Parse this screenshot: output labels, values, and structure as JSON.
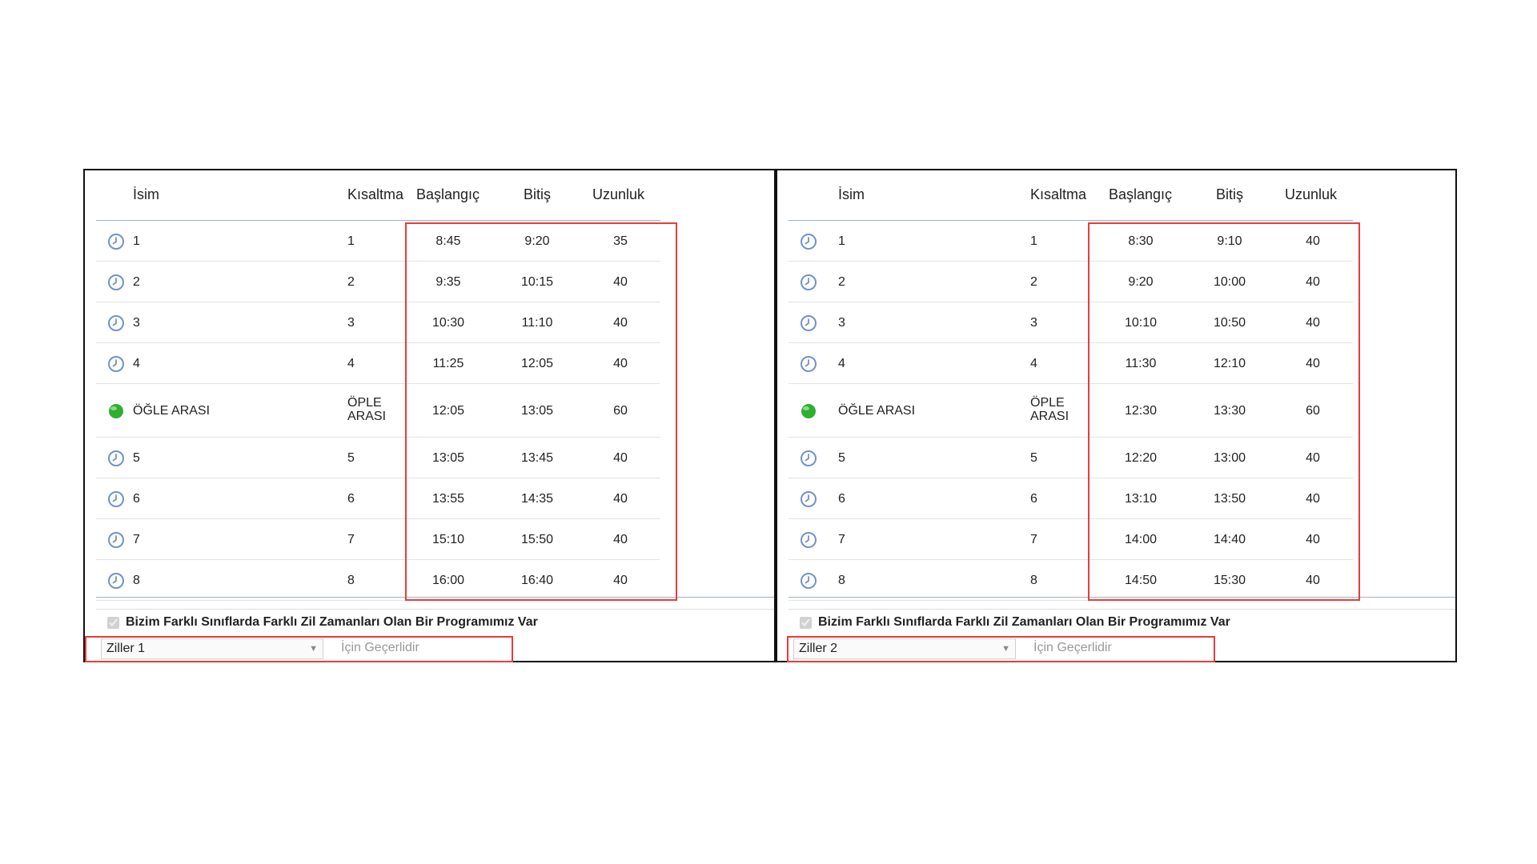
{
  "columns": {
    "name": "İsim",
    "abbr": "Kısaltma",
    "start": "Başlangıç",
    "end": "Bitiş",
    "length": "Uzunluk"
  },
  "left": {
    "rows": [
      {
        "icon": "clock-icon",
        "name": "1",
        "abbr": "1",
        "start": "8:45",
        "end": "9:20",
        "length": "35"
      },
      {
        "icon": "clock-icon",
        "name": "2",
        "abbr": "2",
        "start": "9:35",
        "end": "10:15",
        "length": "40"
      },
      {
        "icon": "clock-icon",
        "name": "3",
        "abbr": "3",
        "start": "10:30",
        "end": "11:10",
        "length": "40"
      },
      {
        "icon": "clock-icon",
        "name": "4",
        "abbr": "4",
        "start": "11:25",
        "end": "12:05",
        "length": "40"
      },
      {
        "icon": "green-dot-icon",
        "name": "ÖĞLE ARASI",
        "abbr_line1": "ÖPLE",
        "abbr_line2": "ARASI",
        "start": "12:05",
        "end": "13:05",
        "length": "60"
      },
      {
        "icon": "clock-icon",
        "name": "5",
        "abbr": "5",
        "start": "13:05",
        "end": "13:45",
        "length": "40"
      },
      {
        "icon": "clock-icon",
        "name": "6",
        "abbr": "6",
        "start": "13:55",
        "end": "14:35",
        "length": "40"
      },
      {
        "icon": "clock-icon",
        "name": "7",
        "abbr": "7",
        "start": "15:10",
        "end": "15:50",
        "length": "40"
      },
      {
        "icon": "clock-icon",
        "name": "8",
        "abbr": "8",
        "start": "16:00",
        "end": "16:40",
        "length": "40"
      }
    ],
    "checkbox_label": "Bizim Farklı Sınıflarda Farklı Zil Zamanları Olan Bir Programımız Var",
    "select_value": "Ziller 1",
    "applies_text": "İçin Geçerlidir"
  },
  "right": {
    "rows": [
      {
        "icon": "clock-icon",
        "name": "1",
        "abbr": "1",
        "start": "8:30",
        "end": "9:10",
        "length": "40"
      },
      {
        "icon": "clock-icon",
        "name": "2",
        "abbr": "2",
        "start": "9:20",
        "end": "10:00",
        "length": "40"
      },
      {
        "icon": "clock-icon",
        "name": "3",
        "abbr": "3",
        "start": "10:10",
        "end": "10:50",
        "length": "40"
      },
      {
        "icon": "clock-icon",
        "name": "4",
        "abbr": "4",
        "start": "11:30",
        "end": "12:10",
        "length": "40"
      },
      {
        "icon": "green-dot-icon",
        "name": "ÖĞLE ARASI",
        "abbr_line1": "ÖPLE",
        "abbr_line2": "ARASI",
        "start": "12:30",
        "end": "13:30",
        "length": "60"
      },
      {
        "icon": "clock-icon",
        "name": "5",
        "abbr": "5",
        "start": "12:20",
        "end": "13:00",
        "length": "40"
      },
      {
        "icon": "clock-icon",
        "name": "6",
        "abbr": "6",
        "start": "13:10",
        "end": "13:50",
        "length": "40"
      },
      {
        "icon": "clock-icon",
        "name": "7",
        "abbr": "7",
        "start": "14:00",
        "end": "14:40",
        "length": "40"
      },
      {
        "icon": "clock-icon",
        "name": "8",
        "abbr": "8",
        "start": "14:50",
        "end": "15:30",
        "length": "40"
      }
    ],
    "checkbox_label": "Bizim Farklı Sınıflarda Farklı Zil Zamanları Olan Bir Programımız Var",
    "select_value": "Ziller 2",
    "applies_text": "İçin Geçerlidir"
  },
  "colors": {
    "clock": "#6f93c9",
    "highlight": "#e83b3b",
    "green": "#2fae2f"
  }
}
